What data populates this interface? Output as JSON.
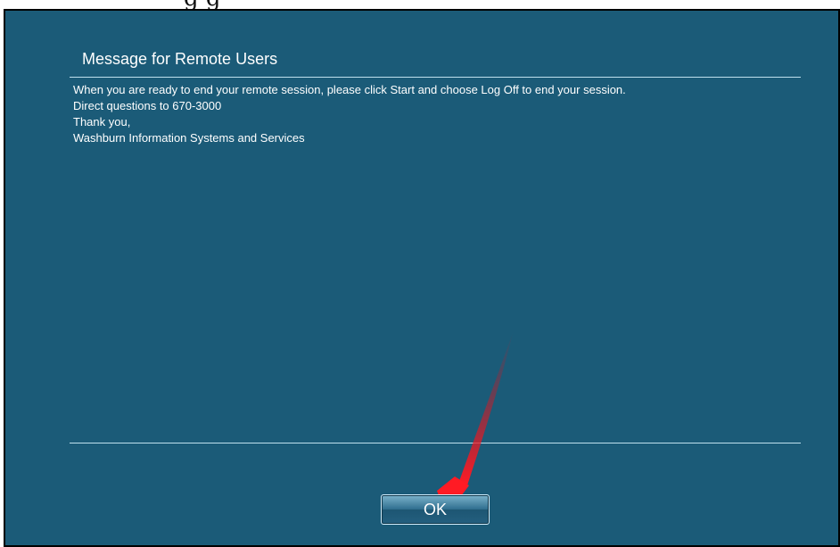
{
  "dialog": {
    "title": "Message for Remote Users",
    "message_lines": [
      "When you are ready to end your remote session, please click Start and choose Log Off to end your session.",
      "Direct questions to 670-3000",
      "Thank you,",
      "Washburn Information Systems and Services"
    ],
    "ok_label": "OK"
  },
  "colors": {
    "background": "#1b5b78",
    "text": "#ffffff",
    "annotation_arrow": "#d8121d"
  }
}
